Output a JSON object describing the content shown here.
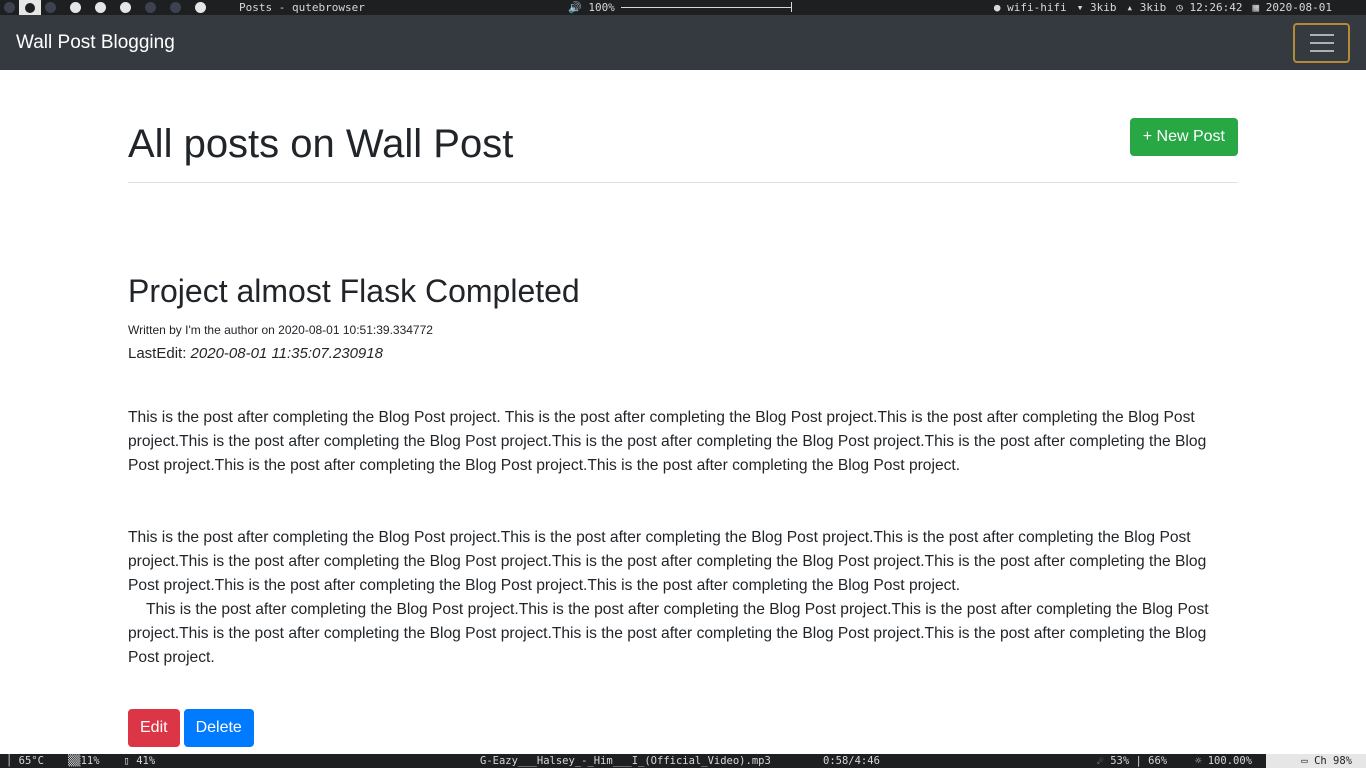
{
  "wm": {
    "window_title": "Posts - qutebrowser",
    "volume": "🔊 100%",
    "wifi": "● wifi-hifi",
    "down": "▾ 3kib",
    "up": "▴ 3kib",
    "time": "◷ 12:26:42",
    "date": "▦ 2020-08-01"
  },
  "navbar": {
    "brand": "Wall Post Blogging"
  },
  "page": {
    "title": "All posts on Wall Post",
    "new_post_label": "+ New Post"
  },
  "post": {
    "title": "Project almost Flask Completed",
    "meta": "Written by I'm the author on 2020-08-01 10:51:39.334772",
    "last_edit_label": "LastEdit: ",
    "last_edit_value": "2020-08-01 11:35:07.230918",
    "paragraph_1": "This is the post after completing the Blog Post project. This is the post after completing the Blog Post project.This is the post after completing the Blog Post project.This is the post after completing the Blog Post project.This is the post after completing the Blog Post project.This is the post after completing the Blog Post project.This is the post after completing the Blog Post project.This is the post after completing the Blog Post project.",
    "paragraph_2": "This is the post after completing the Blog Post project.This is the post after completing the Blog Post project.This is the post after completing the Blog Post project.This is the post after completing the Blog Post project.This is the post after completing the Blog Post project.This is the post after completing the Blog Post project.This is the post after completing the Blog Post project.This is the post after completing the Blog Post project.",
    "paragraph_3": "This is the post after completing the Blog Post project.This is the post after completing the Blog Post project.This is the post after completing the Blog Post project.This is the post after completing the Blog Post project.This is the post after completing the Blog Post project.This is the post after completing the Blog Post project.",
    "edit_label": "Edit",
    "delete_label": "Delete"
  },
  "statusbar": {
    "temp": "│ 65°C",
    "cpu": "▒▒11%",
    "mem": "▯ 41%",
    "track": "G-Eazy___Halsey_-_Him___I_(Official_Video).mp3",
    "track_time": "0:58/4:46",
    "levels": "☄ 53% | 66%",
    "brightness": "☼ 100.00%",
    "battery": "▭ Ch 98%"
  },
  "colors": {
    "navbar_bg": "#343a40",
    "new_post_bg": "#28a745",
    "edit_bg": "#dc3545",
    "delete_bg": "#007bff",
    "toggler_border": "#b38a35"
  }
}
